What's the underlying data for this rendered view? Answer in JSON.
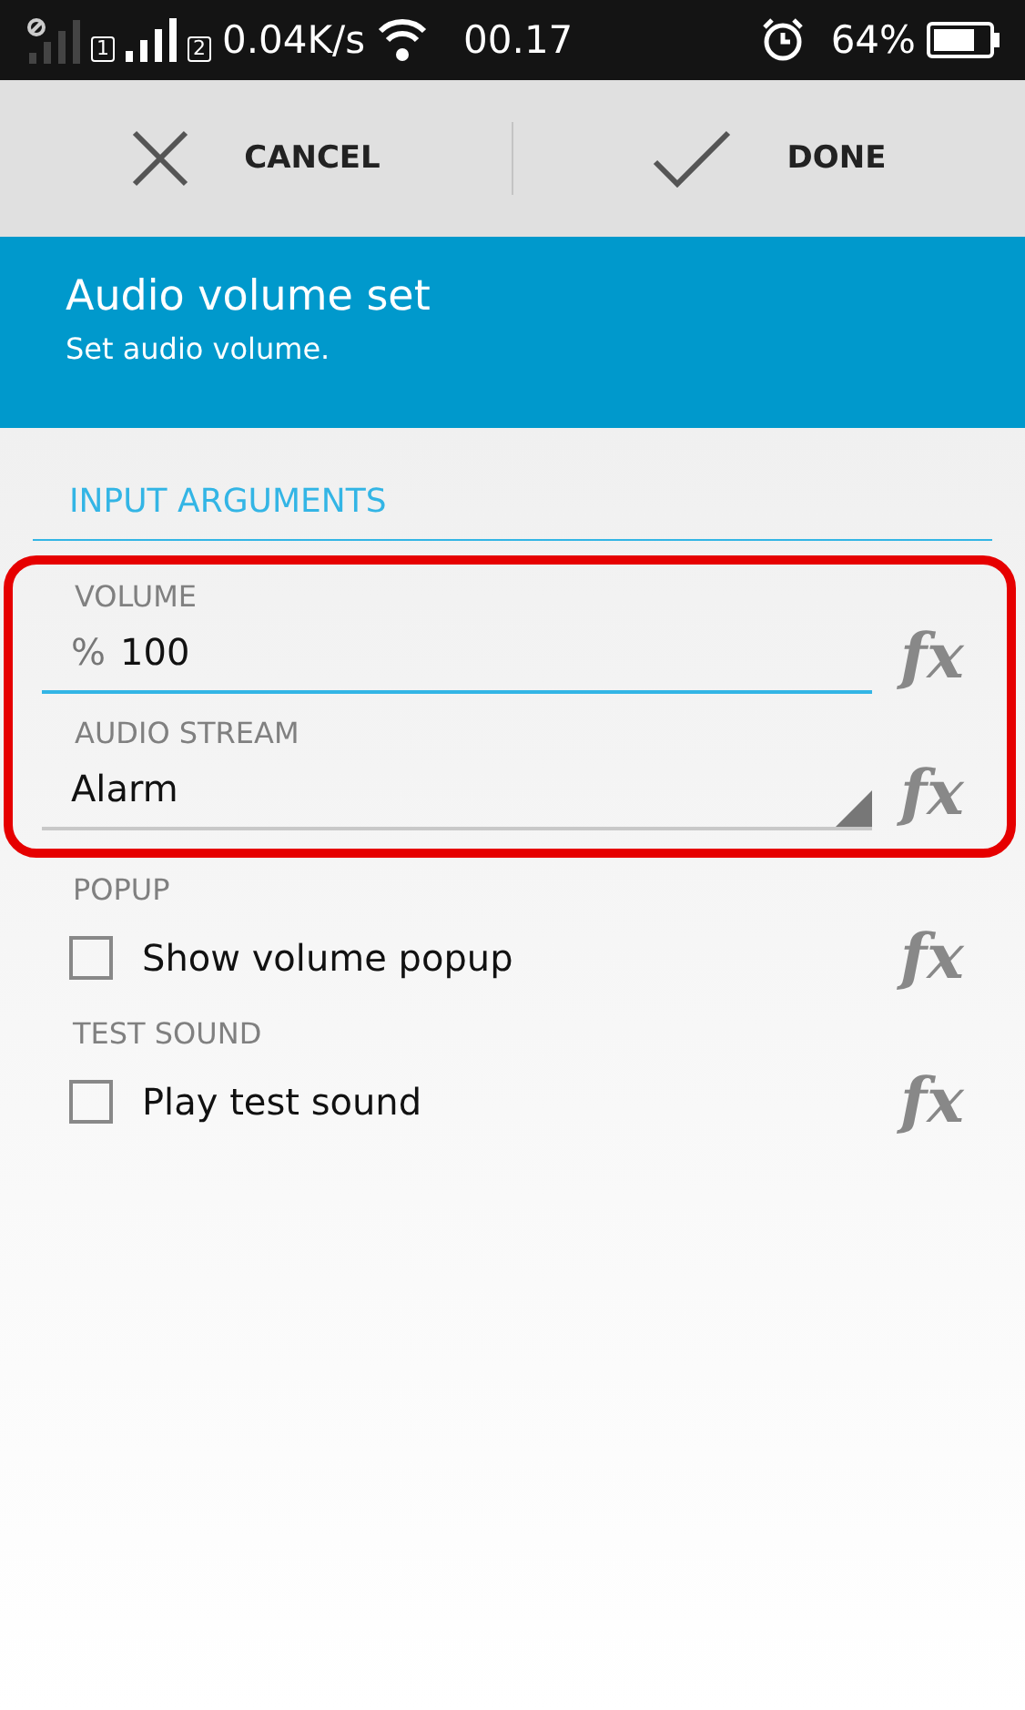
{
  "status_bar": {
    "sim_1": "1",
    "sim_2": "2",
    "speed": "0.04K/s",
    "time": "00.17",
    "battery": "64%"
  },
  "toolbar": {
    "buttons": [
      {
        "kind": "cancel",
        "label": "CANCEL"
      },
      {
        "kind": "done",
        "label": "DONE"
      }
    ]
  },
  "header": {
    "title": "Audio volume set",
    "subtitle": "Set audio volume."
  },
  "section": "INPUT ARGUMENTS",
  "arguments": [
    {
      "kind": "text",
      "label": "VOLUME",
      "prefix": "%",
      "value": "100",
      "focused": true,
      "highlighted": true,
      "fx": "fx"
    },
    {
      "kind": "dropdown",
      "label": "AUDIO STREAM",
      "value": "Alarm",
      "highlighted": true,
      "fx": "fx"
    },
    {
      "kind": "checkbox",
      "label": "POPUP",
      "text": "Show volume popup",
      "checked": false,
      "highlighted": false,
      "fx": "fx"
    },
    {
      "kind": "checkbox",
      "label": "TEST SOUND",
      "text": "Play test sound",
      "checked": false,
      "highlighted": false,
      "fx": "fx"
    }
  ]
}
